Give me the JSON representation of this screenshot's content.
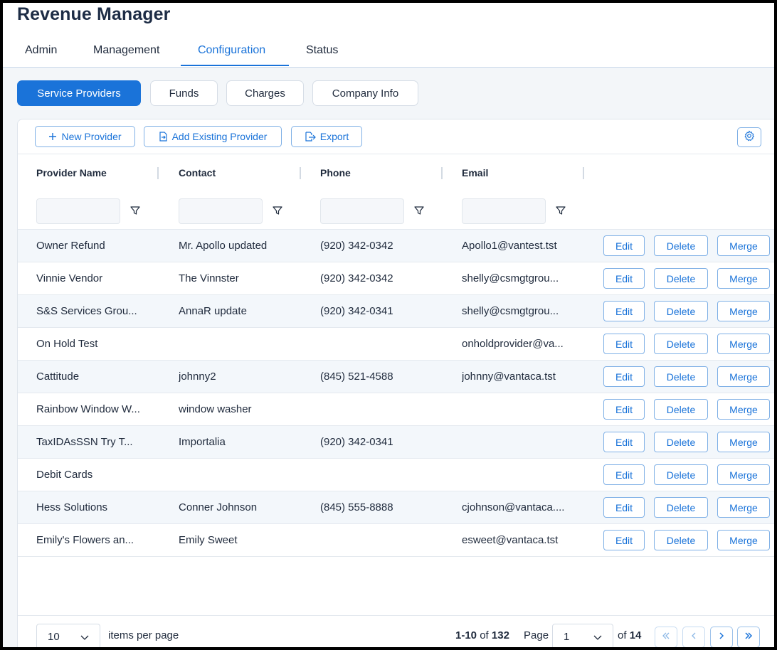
{
  "app": {
    "title": "Revenue Manager"
  },
  "main_tabs": [
    "Admin",
    "Management",
    "Configuration",
    "Status"
  ],
  "active_main_tab": "Configuration",
  "sub_tabs": [
    "Service Providers",
    "Funds",
    "Charges",
    "Company Info"
  ],
  "active_sub_tab": "Service Providers",
  "toolbar": {
    "new_provider": "New Provider",
    "add_existing": "Add Existing Provider",
    "export": "Export"
  },
  "columns": [
    "Provider Name",
    "Contact",
    "Phone",
    "Email"
  ],
  "rows": [
    {
      "name": "Owner Refund",
      "contact": "Mr. Apollo updated",
      "phone": "(920) 342-0342",
      "email": "Apollo1@vantest.tst"
    },
    {
      "name": "Vinnie Vendor",
      "contact": "The Vinnster",
      "phone": "(920) 342-0342",
      "email": "shelly@csmgtgrou..."
    },
    {
      "name": "S&S Services Grou...",
      "contact": "AnnaR update",
      "phone": "(920) 342-0341",
      "email": "shelly@csmgtgrou..."
    },
    {
      "name": "On Hold Test",
      "contact": "",
      "phone": "",
      "email": "onholdprovider@va..."
    },
    {
      "name": "Cattitude",
      "contact": "johnny2",
      "phone": "(845) 521-4588",
      "email": "johnny@vantaca.tst"
    },
    {
      "name": "Rainbow Window W...",
      "contact": "window washer",
      "phone": "",
      "email": ""
    },
    {
      "name": "TaxIDAsSSN Try T...",
      "contact": "Importalia",
      "phone": "(920) 342-0341",
      "email": ""
    },
    {
      "name": "Debit Cards",
      "contact": "",
      "phone": "",
      "email": ""
    },
    {
      "name": "Hess Solutions",
      "contact": "Conner Johnson",
      "phone": "(845) 555-8888",
      "email": "cjohnson@vantaca...."
    },
    {
      "name": "Emily's Flowers an...",
      "contact": "Emily Sweet",
      "phone": "",
      "email": "esweet@vantaca.tst"
    }
  ],
  "row_actions": {
    "edit": "Edit",
    "delete": "Delete",
    "merge": "Merge"
  },
  "pagination": {
    "page_size": "10",
    "items_per_page_label": "items per page",
    "range": "1-10",
    "of_word": "of",
    "total": "132",
    "page_label": "Page",
    "current_page": "1",
    "total_pages": "14"
  },
  "colors": {
    "accent": "#1a73d9",
    "row_alt": "#f3f7fb",
    "border": "#7fb0e6"
  },
  "icons": [
    "plus-icon",
    "add-existing-icon",
    "export-icon",
    "gear-icon",
    "filter-icon",
    "chevron-down-icon",
    "first-page-icon",
    "prev-page-icon",
    "next-page-icon",
    "last-page-icon"
  ]
}
